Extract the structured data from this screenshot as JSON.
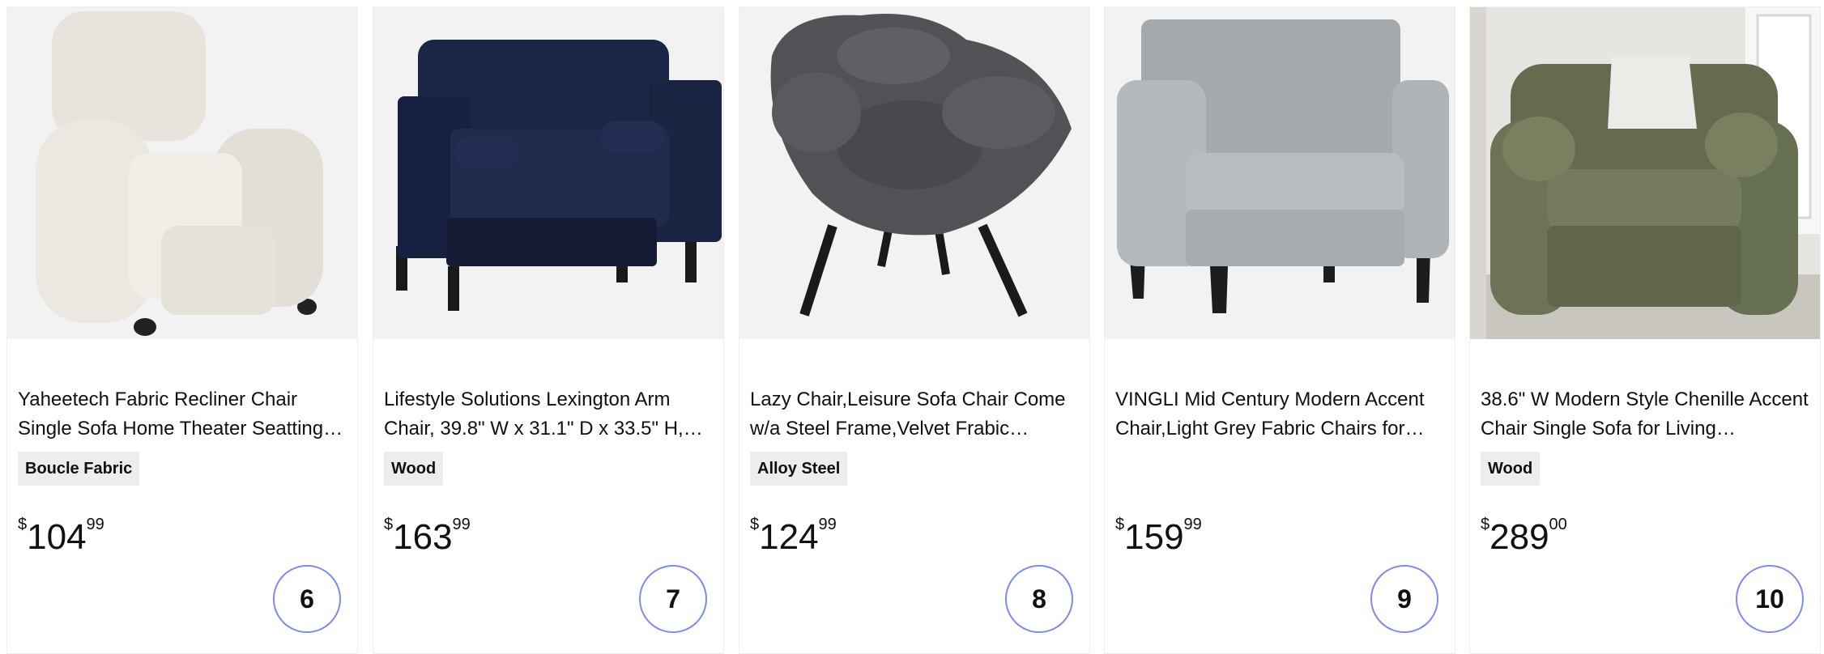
{
  "products": [
    {
      "title": "Yaheetech Fabric Recliner Chair Single Sofa Home Theater Seatting…",
      "badge": "Boucle Fabric",
      "price": {
        "symbol": "$",
        "whole": "104",
        "fraction": "99"
      },
      "rank": "6",
      "image_color": "#efece5"
    },
    {
      "title": "Lifestyle Solutions Lexington Arm Chair, 39.8\" W x 31.1\" D x 33.5\" H,…",
      "badge": "Wood",
      "price": {
        "symbol": "$",
        "whole": "163",
        "fraction": "99"
      },
      "rank": "7",
      "image_color": "#1c2644"
    },
    {
      "title": "Lazy Chair,Leisure Sofa Chair Come w/a Steel Frame,Velvet Frabic…",
      "badge": "Alloy Steel",
      "price": {
        "symbol": "$",
        "whole": "124",
        "fraction": "99"
      },
      "rank": "8",
      "image_color": "#4e4f53"
    },
    {
      "title": "VINGLI Mid Century Modern Accent Chair,Light Grey Fabric Chairs for…",
      "badge": "",
      "price": {
        "symbol": "$",
        "whole": "159",
        "fraction": "99"
      },
      "rank": "9",
      "image_color": "#aeb3b8"
    },
    {
      "title": "38.6\" W Modern Style Chenille Accent Chair Single Sofa for Living…",
      "badge": "Wood",
      "price": {
        "symbol": "$",
        "whole": "289",
        "fraction": "00"
      },
      "rank": "10",
      "image_color": "#6a7154"
    }
  ]
}
